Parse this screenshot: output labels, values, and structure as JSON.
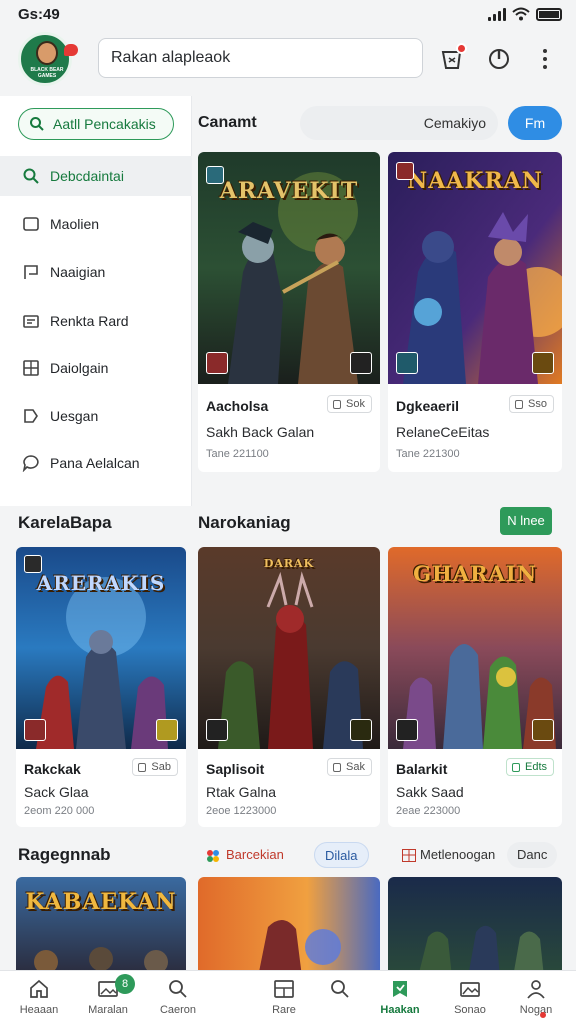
{
  "status": {
    "time": "Gs:49"
  },
  "header": {
    "avatar_text": "BLACK BEAR GAMES",
    "search_placeholder": "Rakan alapleaok"
  },
  "sidebar": {
    "top_button": "Aatll Pencakakis",
    "items": [
      {
        "label": "Debcdaintai",
        "icon": "search-icon",
        "active": true
      },
      {
        "label": "Maolien",
        "icon": "window-icon"
      },
      {
        "label": "Naaigian",
        "icon": "flag-icon"
      },
      {
        "label": "Renkta Rard",
        "icon": "card-icon"
      },
      {
        "label": "Daiolgain",
        "icon": "grid-icon"
      },
      {
        "label": "Uesgan",
        "icon": "tag-icon"
      },
      {
        "label": "Pana Aelalcan",
        "icon": "chat-icon"
      }
    ]
  },
  "top_section": {
    "title": "Canamt",
    "tab_label": "Cemakiyo",
    "button": "Fm"
  },
  "featured": [
    {
      "art_title": "ARAVEKIT",
      "name": "Aacholsa",
      "subtitle": "Sakh Back Galan",
      "meta": "Tane 221100",
      "tag": "Sok",
      "tag_green": false
    },
    {
      "art_title": "NAAKRAN",
      "name": "Dgkeaeril",
      "subtitle": "RelaneCeEitas",
      "meta": "Tane 221300",
      "tag": "Sso",
      "tag_green": false
    }
  ],
  "section2": {
    "left_title": "KarelaBapa",
    "right_title": "Narokaniag",
    "button": "N lnee",
    "cards": [
      {
        "art_title": "ARERAKIS",
        "name": "Rakckak",
        "subtitle": "Sack Glaa",
        "meta": "2eom 220 000",
        "tag": "Sab",
        "tag_green": false
      },
      {
        "art_title": "DARAK",
        "name": "Saplisoit",
        "subtitle": "Rtak Galna",
        "meta": "2eoe 1223000",
        "tag": "Sak",
        "tag_green": false
      },
      {
        "art_title": "GHARAIN",
        "name": "Balarkit",
        "subtitle": "Sakk Saad",
        "meta": "2eae 223000",
        "tag": "Edts",
        "tag_green": true
      }
    ]
  },
  "section3": {
    "title": "Ragegnnab",
    "chip1": "Barcekian",
    "chip2": "Dilala",
    "chip3": "Metlenoogan",
    "chip4": "Danc",
    "cards": [
      {
        "art_title": "KABAEKAN"
      },
      {
        "art_title": ""
      },
      {
        "art_title": ""
      }
    ]
  },
  "bottom_nav": {
    "badge": "8",
    "items": [
      {
        "label": "Heaaan",
        "icon": "home-icon"
      },
      {
        "label": "Maralan",
        "icon": "image-icon"
      },
      {
        "label": "Caeron",
        "icon": "search-icon"
      },
      {
        "label": "Rare",
        "icon": "grid-card-icon"
      },
      {
        "label": "",
        "icon": "search-icon"
      },
      {
        "label": "Haakan",
        "icon": "bookmark-icon",
        "active": true
      },
      {
        "label": "Sonao",
        "icon": "gallery-icon"
      },
      {
        "label": "Nogan",
        "icon": "profile-icon"
      }
    ]
  },
  "colors": {
    "accent_green": "#2e9a5a",
    "accent_blue": "#2f8de4",
    "badge_red": "#e53935"
  }
}
